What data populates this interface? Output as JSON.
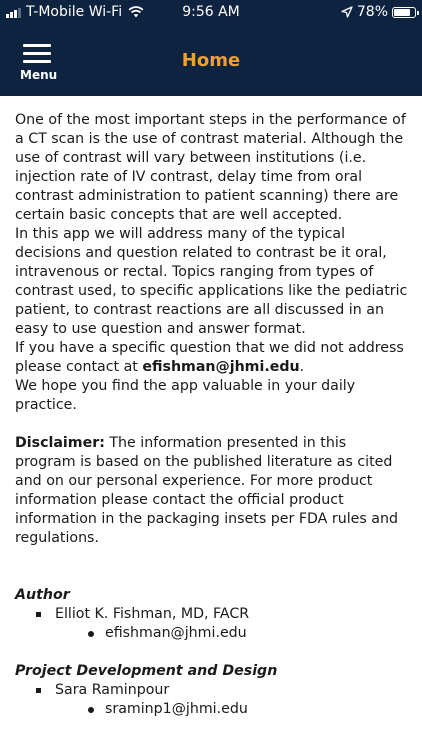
{
  "status": {
    "carrier": "T-Mobile Wi-Fi",
    "time": "9:56 AM",
    "battery": "78%",
    "battery_level": 0.78
  },
  "nav": {
    "menu_label": "Menu",
    "title": "Home"
  },
  "intro": {
    "p1": "One of the most important steps in the performance of a CT scan is the use of contrast material. Although the use of contrast will vary between institutions (i.e. injection rate of IV contrast, delay time from oral contrast administration to patient scanning) there are certain basic concepts that are well accepted.",
    "p2": "In this app we will address many of the typical decisions and question related to contrast be it oral, intravenous or rectal. Topics ranging from types of contrast used, to specific applications like the pediatric patient, to contrast reactions are all discussed in an easy to use question and answer format.",
    "p3_prefix": "If you have a specific question that we did not address please contact at ",
    "p3_email": "efishman@jhmi.edu",
    "p3_suffix": ".",
    "p4": "We hope you find the app valuable in your daily practice."
  },
  "disclaimer": {
    "label": "Disclaimer:",
    "text": " The information presented in this program is based on the published literature as cited and on our personal experience. For more product information please contact the official product information in the packaging insets per FDA rules and regulations."
  },
  "author": {
    "heading": "Author",
    "name": "Elliot K. Fishman, MD, FACR",
    "email": "efishman@jhmi.edu"
  },
  "project": {
    "heading": "Project Development and Design",
    "name": "Sara Raminpour",
    "email": "sraminp1@jhmi.edu"
  }
}
